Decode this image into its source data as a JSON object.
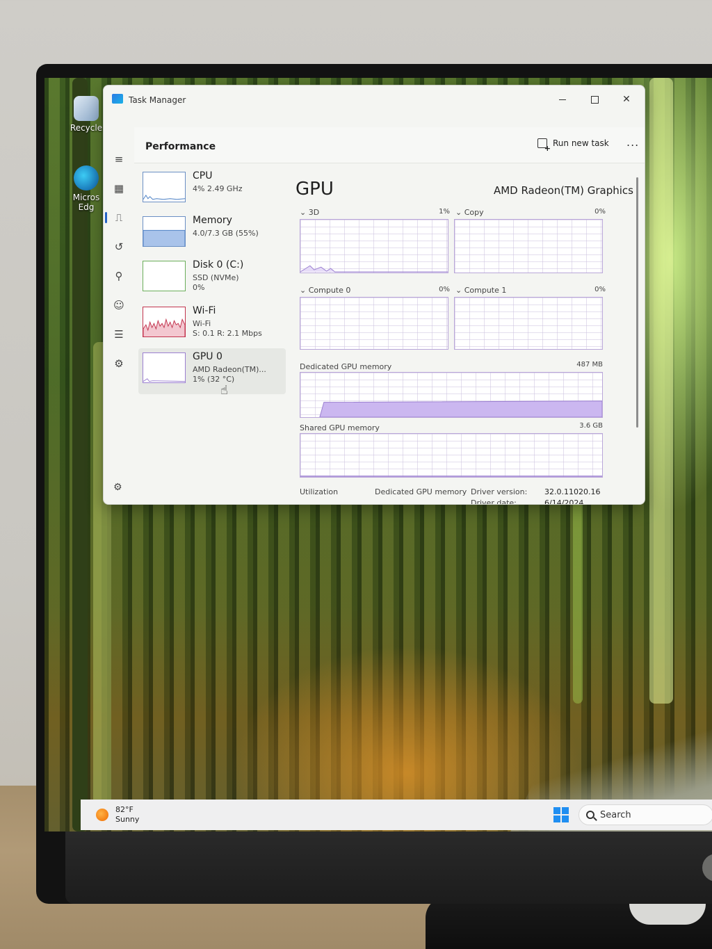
{
  "desktop": {
    "icons": [
      {
        "label": "Recycle"
      },
      {
        "label": "Micros Edg"
      }
    ]
  },
  "window": {
    "title": "Task Manager"
  },
  "header": {
    "title": "Performance",
    "run_new_task": "Run new task",
    "more": "..."
  },
  "devices": [
    {
      "name": "CPU",
      "line1": "4% 2.49 GHz",
      "line2": ""
    },
    {
      "name": "Memory",
      "line1": "4.0/7.3 GB (55%)",
      "line2": ""
    },
    {
      "name": "Disk 0 (C:)",
      "line1": "SSD (NVMe)",
      "line2": "0%"
    },
    {
      "name": "Wi-Fi",
      "line1": "Wi-Fi",
      "line2": "S: 0.1 R: 2.1 Mbps"
    },
    {
      "name": "GPU 0",
      "line1": "AMD Radeon(TM)...",
      "line2": "1% (32 °C)"
    }
  ],
  "gpu": {
    "title": "GPU",
    "model": "AMD Radeon(TM) Graphics",
    "engines": [
      {
        "label": "3D",
        "value": "1%"
      },
      {
        "label": "Copy",
        "value": "0%"
      },
      {
        "label": "Compute 0",
        "value": "0%"
      },
      {
        "label": "Compute 1",
        "value": "0%"
      }
    ],
    "dedicated_label": "Dedicated GPU memory",
    "dedicated_max": "487 MB",
    "shared_label": "Shared GPU memory",
    "shared_max": "3.6 GB",
    "stats": {
      "utilization_label": "Utilization",
      "dedicated_label": "Dedicated GPU memory",
      "driver_version_label": "Driver version:",
      "driver_version": "32.0.11020.16",
      "driver_date_label": "Driver date:",
      "driver_date": "6/14/2024"
    }
  },
  "taskbar": {
    "temp": "82°F",
    "condition": "Sunny",
    "search": "Search"
  },
  "colors": {
    "accent": "#2563c7",
    "graph_line": "#9b7fd1",
    "graph_fill": "#cbb7f0",
    "wifi_line": "#c2334d"
  }
}
